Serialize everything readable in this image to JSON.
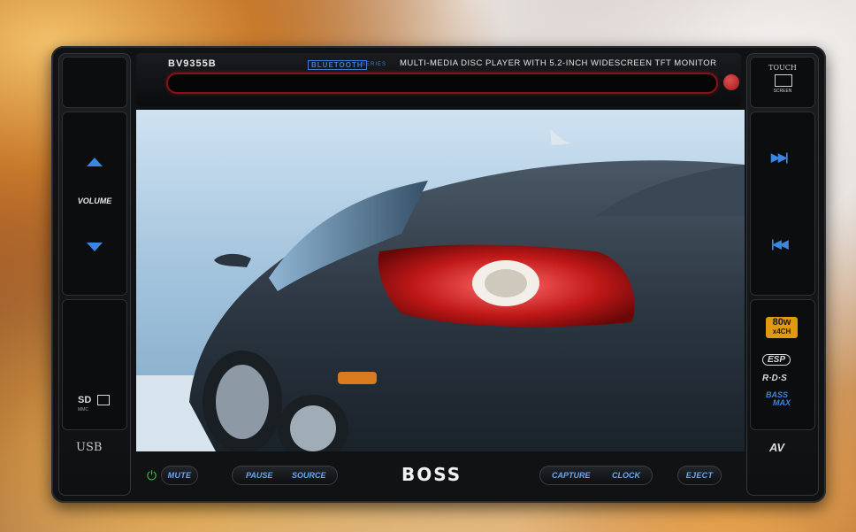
{
  "header": {
    "model": "BV9355B",
    "bluetooth_badge": "BLUETOOTH",
    "bluetooth_suffix": "SERIES",
    "description": "MULTI-MEDIA DISC PLAYER WITH 5.2-INCH WIDESCREEN TFT MONITOR",
    "touch_label_1": "TOUCH",
    "touch_label_2": "SCREEN"
  },
  "left_panel": {
    "volume_label": "VOLUME",
    "sd_label": "SD",
    "mmc_label": "MMC",
    "usb_label": "USB"
  },
  "right_panel": {
    "power_badge_1": "80w",
    "power_badge_2": "x4CH",
    "esp_label": "ESP",
    "rds_label": "R·D·S",
    "bass_label_1": "BASS",
    "bass_label_2": "MAX",
    "av_label": "AV"
  },
  "bottom_bar": {
    "mute": "MUTE",
    "pause": "PAUSE",
    "source": "SOURCE",
    "brand": "BOSS",
    "capture": "CAPTURE",
    "clock": "CLOCK",
    "eject": "EJECT"
  },
  "colors": {
    "accent_blue": "#3a86e0",
    "power_green": "#33d13a",
    "slot_red": "#c0202a"
  }
}
